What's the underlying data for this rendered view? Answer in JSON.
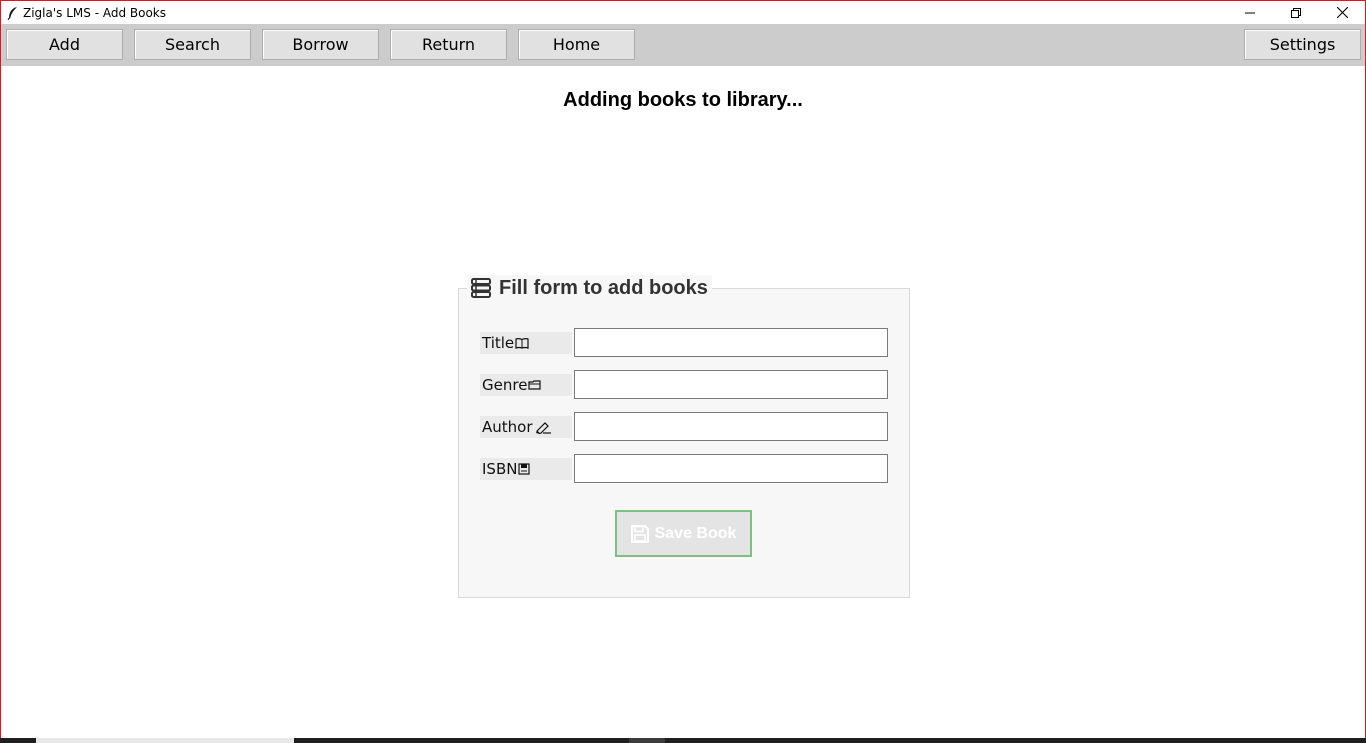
{
  "window": {
    "title": "Zigla's LMS - Add Books",
    "app_icon": "feather-icon",
    "controls": [
      "minimize-icon",
      "restore-icon",
      "close-icon"
    ]
  },
  "toolbar": {
    "buttons": [
      {
        "label": "Add"
      },
      {
        "label": "Search"
      },
      {
        "label": "Borrow"
      },
      {
        "label": "Return"
      },
      {
        "label": "Home"
      }
    ],
    "settings_label": "Settings"
  },
  "main": {
    "heading": "Adding books to library..."
  },
  "form": {
    "legend": "Fill form to add books",
    "legend_icon": "books-icon",
    "fields": [
      {
        "label": "Title",
        "icon": "book-icon",
        "value": ""
      },
      {
        "label": "Genre",
        "icon": "folder-icon",
        "value": ""
      },
      {
        "label": "Author",
        "icon": "pen-icon",
        "value": ""
      },
      {
        "label": "ISBN",
        "icon": "barcode-icon",
        "value": ""
      }
    ],
    "save_label": "Save Book",
    "save_icon": "floppy-disk-icon"
  },
  "colors": {
    "window_border": "#e81123",
    "toolbar_bg": "#cccccc",
    "save_border": "#7fbf7f"
  }
}
